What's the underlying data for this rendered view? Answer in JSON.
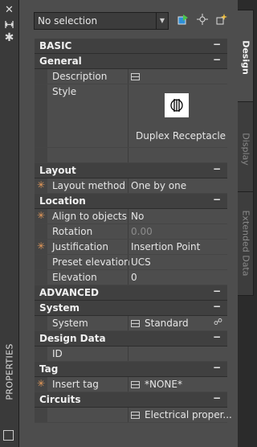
{
  "palette": {
    "title": "PROPERTIES",
    "close_icon": "close-icon",
    "autohide_icon": "autohide-icon",
    "settings_icon": "gear-icon"
  },
  "selection": {
    "value": "No selection"
  },
  "tabs": {
    "design": "Design",
    "display": "Display",
    "extended": "Extended Data"
  },
  "sections": {
    "basic": "BASIC",
    "general": "General",
    "layout": "Layout",
    "location": "Location",
    "advanced": "ADVANCED",
    "system": "System",
    "design_data": "Design Data",
    "tag": "Tag",
    "circuits": "Circuits",
    "collapse": "−"
  },
  "general": {
    "description_label": "Description",
    "style_label": "Style",
    "style_value": "Duplex Receptacle"
  },
  "layout": {
    "method_label": "Layout method",
    "method_value": "One by one"
  },
  "location": {
    "align_label": "Align to objects",
    "align_value": "No",
    "rotation_label": "Rotation",
    "rotation_value": "0.00",
    "justification_label": "Justification",
    "justification_value": "Insertion Point",
    "preset_label": "Preset elevation",
    "preset_value": "UCS",
    "elevation_label": "Elevation",
    "elevation_value": "0"
  },
  "system": {
    "label": "System",
    "value": "Standard"
  },
  "design_data": {
    "id_label": "ID"
  },
  "tag": {
    "insert_label": "Insert tag",
    "insert_value": "*NONE*"
  },
  "circuits": {
    "value": "Electrical  proper..."
  }
}
